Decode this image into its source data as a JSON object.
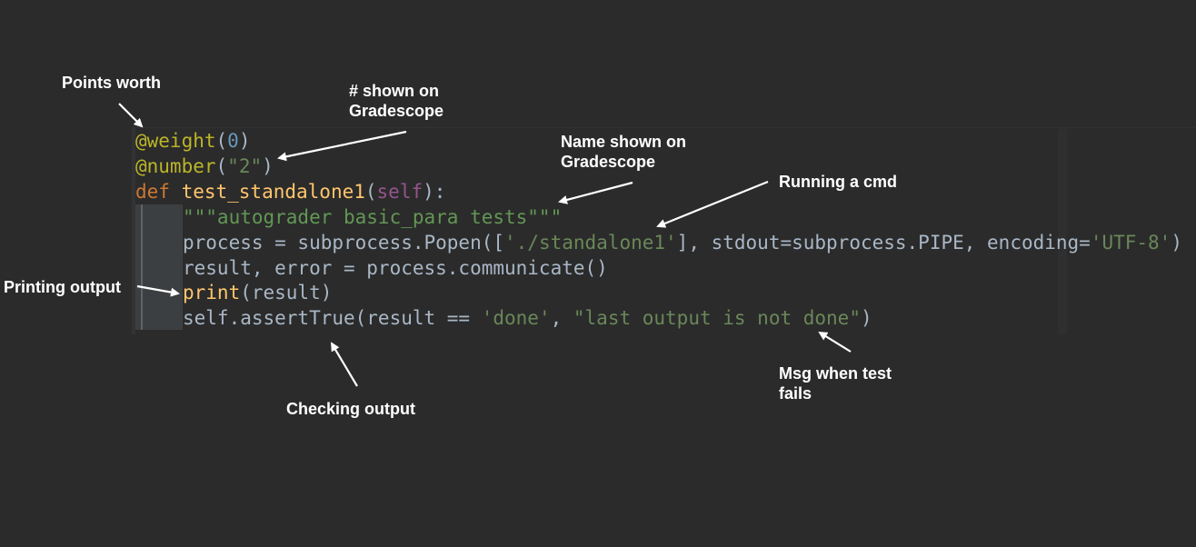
{
  "code": {
    "line1": {
      "decorator": "@weight",
      "open": "(",
      "value": "0",
      "close": ")"
    },
    "line2": {
      "decorator": "@number",
      "open": "(",
      "value": "\"2\"",
      "close": ")"
    },
    "line3": {
      "keyword": "def ",
      "name": "test_standalone1",
      "open": "(",
      "param": "self",
      "close": "):"
    },
    "line4": {
      "docstring": "\"\"\"autograder basic_para tests\"\"\""
    },
    "line5": {
      "part1": "process = subprocess.Popen([",
      "arg": "'./standalone1'",
      "part2": "], stdout=subprocess.PIPE, encoding=",
      "enc": "'UTF-8'",
      "part3": ")"
    },
    "line6": {
      "text": "result, error = process.communicate()"
    },
    "line7": {
      "fn": "print",
      "rest": "(result)"
    },
    "line8": {
      "part1": "self.assertTrue(result == ",
      "s1": "'done'",
      "sep": ", ",
      "s2": "\"last output is not done\"",
      "close": ")"
    }
  },
  "annotations": {
    "points_worth": "Points worth",
    "number_shown": "# shown on\nGradescope",
    "name_shown": "Name shown on\nGradescope",
    "running_cmd": "Running a cmd",
    "printing_output": "Printing output",
    "checking_output": "Checking output",
    "msg_when_fails": "Msg when test\nfails"
  },
  "colors": {
    "background": "#2b2b2b",
    "decorator": "#bbb529",
    "keyword": "#cc7832",
    "function": "#ffc66d",
    "string": "#6a8759",
    "number": "#6897bb",
    "annotation_text": "#ffffff"
  }
}
